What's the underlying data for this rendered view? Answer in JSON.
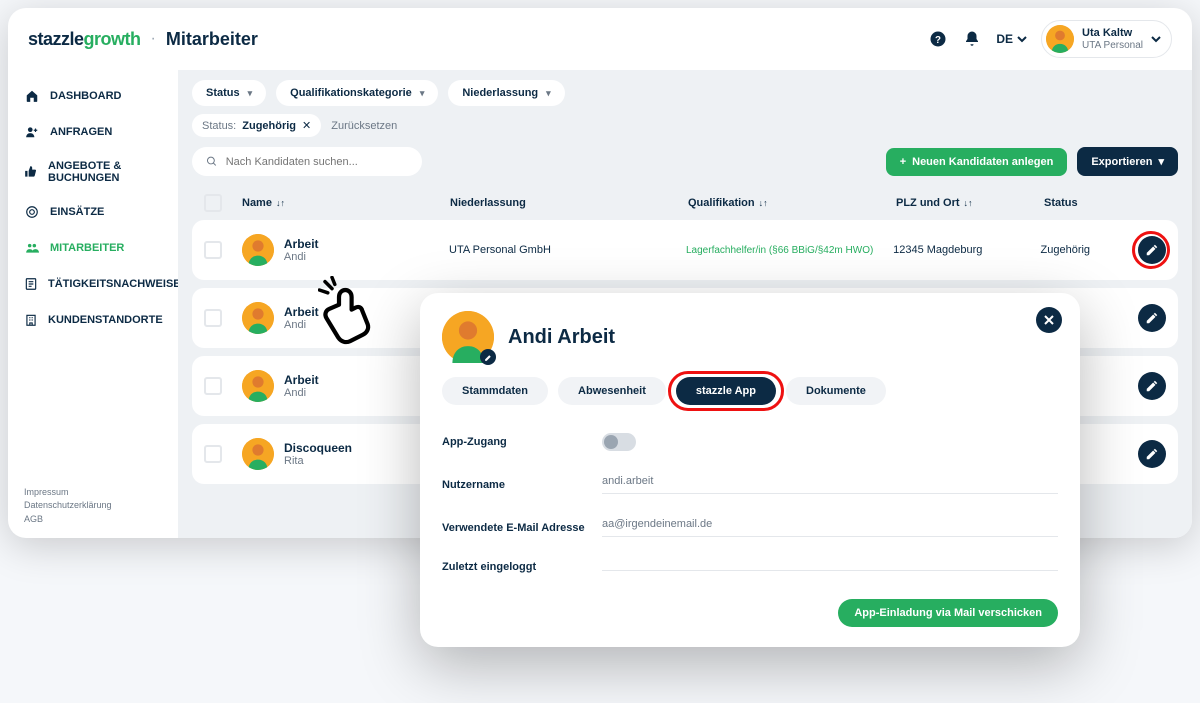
{
  "brand": {
    "part1": "stazzle",
    "part2": "growth"
  },
  "page_title": "Mitarbeiter",
  "lang": "DE",
  "user": {
    "name": "Uta Kaltw",
    "org": "UTA Personal"
  },
  "sidebar": {
    "items": [
      {
        "label": "DASHBOARD"
      },
      {
        "label": "ANFRAGEN"
      },
      {
        "label": "ANGEBOTE & BUCHUNGEN"
      },
      {
        "label": "EINSÄTZE"
      },
      {
        "label": "MITARBEITER"
      },
      {
        "label": "TÄTIGKEITSNACHWEISE"
      },
      {
        "label": "KUNDENSTANDORTE"
      }
    ],
    "footer": {
      "imp": "Impressum",
      "ds": "Datenschutzerklärung",
      "agb": "AGB"
    }
  },
  "filters": {
    "status": "Status",
    "qual": "Qualifikationskategorie",
    "nieder": "Niederlassung",
    "tag_label": "Status:",
    "tag_value": "Zugehörig",
    "reset": "Zurücksetzen"
  },
  "toolbar": {
    "search_ph": "Nach Kandidaten suchen...",
    "add": "Neuen Kandidaten anlegen",
    "export": "Exportieren"
  },
  "table": {
    "head": {
      "name": "Name",
      "nied": "Niederlassung",
      "qual": "Qualifikation",
      "plz": "PLZ und Ort",
      "status": "Status"
    },
    "rows": [
      {
        "name": "Arbeit",
        "first": "Andi",
        "nied": "UTA Personal GmbH",
        "qual": "Lagerfachhelfer/in (§66 BBiG/§42m HWO)",
        "plz": "12345 Magdeburg",
        "status": "Zugehörig",
        "highlight": true
      },
      {
        "name": "Arbeit",
        "first": "Andi"
      },
      {
        "name": "Arbeit",
        "first": "Andi"
      },
      {
        "name": "Discoqueen",
        "first": "Rita"
      }
    ]
  },
  "panel": {
    "title": "Andi Arbeit",
    "tabs": {
      "stamm": "Stammdaten",
      "abw": "Abwesenheit",
      "app": "stazzle App",
      "dok": "Dokumente"
    },
    "form": {
      "access_label": "App-Zugang",
      "user_label": "Nutzername",
      "user_val": "andi.arbeit",
      "email_label": "Verwendete E-Mail Adresse",
      "email_val": "aa@irgendeinemail.de",
      "last_label": "Zuletzt eingeloggt",
      "last_val": ""
    },
    "send": "App-Einladung via Mail verschicken"
  }
}
